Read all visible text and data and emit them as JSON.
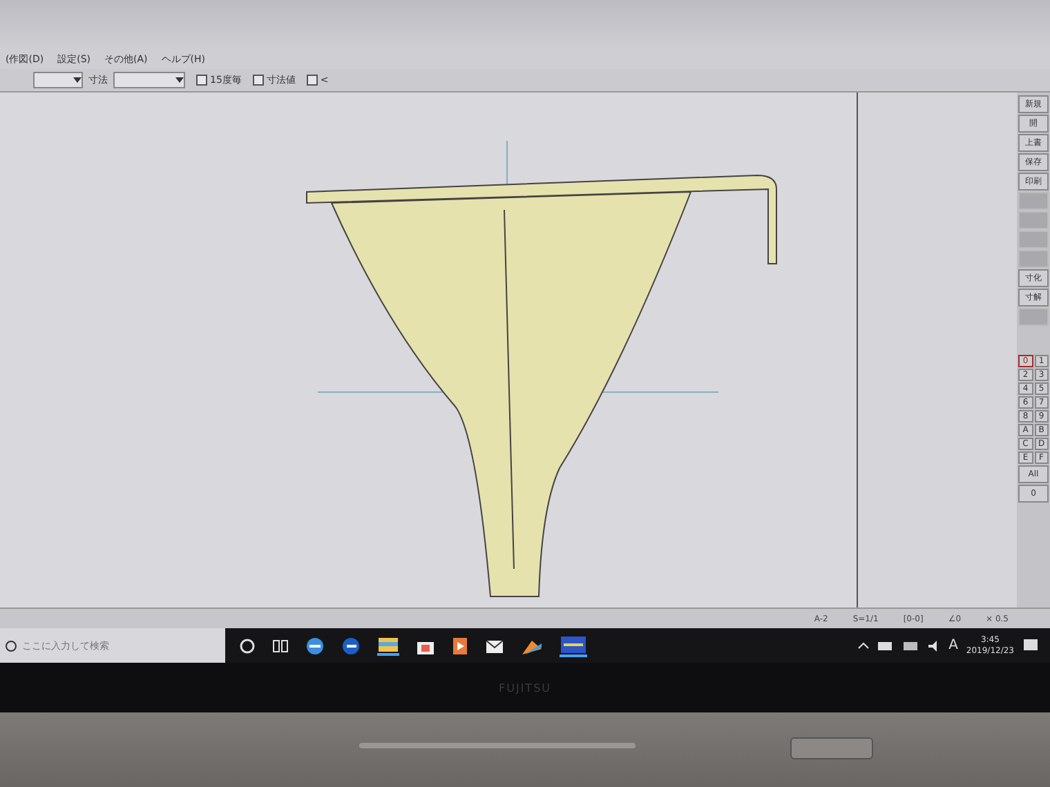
{
  "menu": [
    {
      "label": "(作図(D)"
    },
    {
      "label": "設定(S)"
    },
    {
      "label": "その他(A)"
    },
    {
      "label": "ヘルプ(H)"
    }
  ],
  "toolbar": {
    "field_label": "寸法",
    "checkboxes": [
      {
        "label": "15度毎",
        "checked": false
      },
      {
        "label": "寸法値",
        "checked": false
      },
      {
        "label": "<",
        "checked": false
      }
    ]
  },
  "side_buttons": [
    {
      "label": "新規",
      "disabled": false
    },
    {
      "label": "開",
      "disabled": false
    },
    {
      "label": "上書",
      "disabled": false
    },
    {
      "label": "保存",
      "disabled": false
    },
    {
      "label": "印刷",
      "disabled": false
    },
    {
      "disabled": true
    },
    {
      "disabled": true
    },
    {
      "disabled": true
    },
    {
      "disabled": true
    },
    {
      "label": "寸化",
      "disabled": false
    },
    {
      "label": "寸解",
      "disabled": false
    },
    {
      "disabled": true
    }
  ],
  "layers": [
    {
      "label": "0",
      "selected": true
    },
    {
      "label": "1",
      "selected": false
    },
    {
      "label": "2",
      "selected": false
    },
    {
      "label": "3",
      "selected": false
    },
    {
      "label": "4",
      "selected": false
    },
    {
      "label": "5",
      "selected": false
    },
    {
      "label": "6",
      "selected": false
    },
    {
      "label": "7",
      "selected": false
    },
    {
      "label": "8",
      "selected": false
    },
    {
      "label": "9",
      "selected": false
    },
    {
      "label": "A",
      "selected": false
    },
    {
      "label": "B",
      "selected": false
    },
    {
      "label": "C",
      "selected": false
    },
    {
      "label": "D",
      "selected": false
    },
    {
      "label": "E",
      "selected": false
    },
    {
      "label": "F",
      "selected": false
    }
  ],
  "layer_extra": [
    "All",
    "0"
  ],
  "status_bar": {
    "fields": [
      "A-2",
      "S=1/1",
      "[0-0]",
      "∠0",
      "× 0.5"
    ]
  },
  "taskbar": {
    "search": {
      "placeholder": "ここに入力して検索"
    },
    "ime": "A",
    "time": "3:45",
    "date": "2019/12/23"
  },
  "bezel": {
    "brand": "FUJITSU"
  }
}
